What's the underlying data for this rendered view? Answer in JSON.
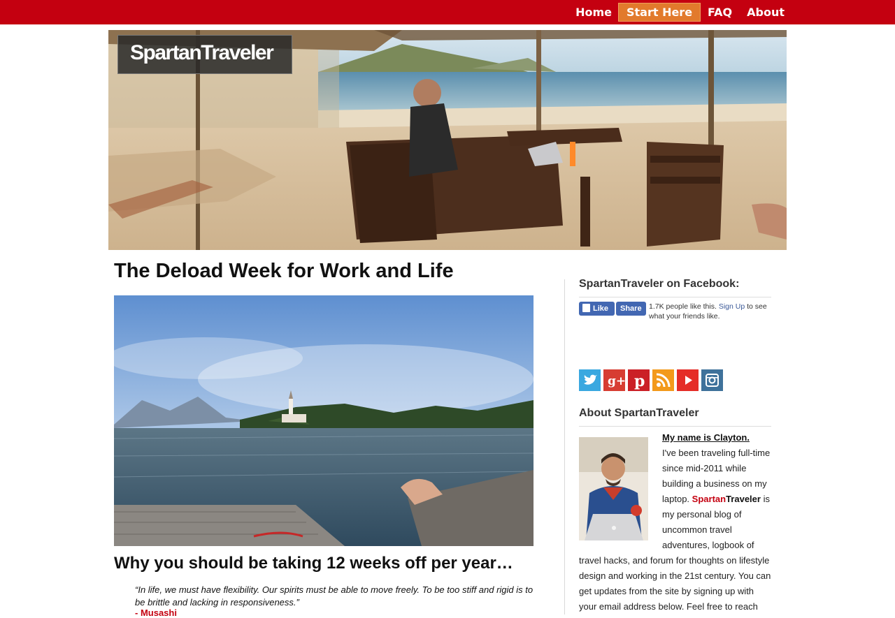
{
  "nav": {
    "home": "Home",
    "start_here": "Start Here",
    "faq": "FAQ",
    "about": "About"
  },
  "logo": {
    "text": "SpartanTraveler"
  },
  "post": {
    "title": "The Deload Week for Work and Life",
    "subheading": "Why you should be taking 12 weeks off per year…",
    "quote": "“In life, we must have flexibility. Our spirits must be able to move freely. To be too stiff and rigid is to be brittle and lacking in responsiveness.”",
    "quote_author": "- Musashi"
  },
  "sidebar": {
    "facebook": {
      "title": "SpartanTraveler on Facebook:",
      "like_label": "Like",
      "share_label": "Share",
      "count_text": "1.7K people like this.",
      "signup_link": "Sign Up",
      "signup_suffix": "to see what your friends like."
    },
    "social_icons": [
      {
        "name": "twitter-icon",
        "color": "#3aa8e0"
      },
      {
        "name": "google-plus-icon",
        "color": "#d73d32"
      },
      {
        "name": "pinterest-icon",
        "color": "#cb2027"
      },
      {
        "name": "rss-icon",
        "color": "#f39a1b"
      },
      {
        "name": "youtube-icon",
        "color": "#e52d27"
      },
      {
        "name": "instagram-icon",
        "color": "#3f729b"
      }
    ],
    "about": {
      "title": "About SpartanTraveler",
      "name_line": "My name is Clayton.",
      "bio_part1": "I've been traveling full-time since mid-2011 while building a business on my laptop.",
      "brand_spartan": "Spartan",
      "brand_traveler": "Traveler",
      "bio_part2": "is my personal blog of uncommon travel adventures, logbook of travel hacks, and forum for thoughts on lifestyle design and working in the 21st century. You can get updates from the site by signing up with your email address below. Feel free to reach"
    }
  },
  "colors": {
    "brand_red": "#c40010",
    "start_here_orange": "#e27a2c",
    "facebook_blue": "#4267b2"
  }
}
